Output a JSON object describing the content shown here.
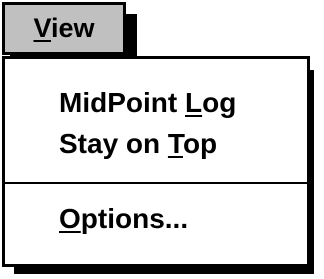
{
  "menu": {
    "title_mnemonic": "V",
    "title_rest": "iew",
    "items": [
      {
        "before": "MidPoint ",
        "mnemonic": "L",
        "after": "og"
      },
      {
        "before": "Stay on ",
        "mnemonic": "T",
        "after": "op"
      },
      {
        "before": "",
        "mnemonic": "O",
        "after": "ptions..."
      }
    ]
  }
}
